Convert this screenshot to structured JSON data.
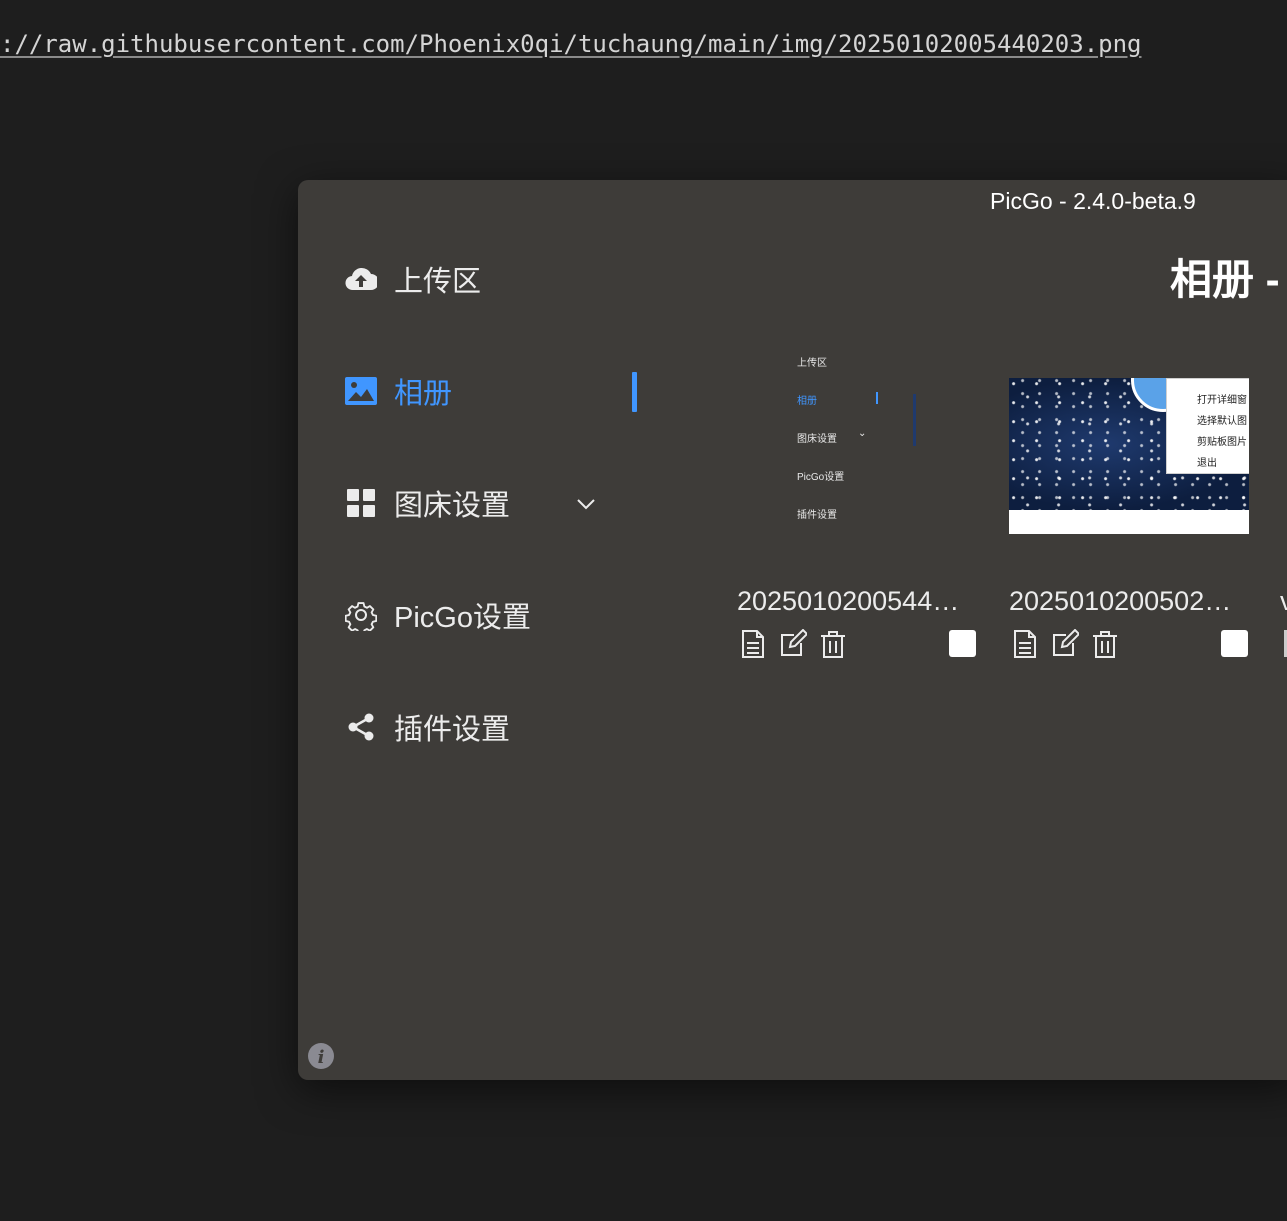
{
  "background_url": "://raw.githubusercontent.com/Phoenix0qi/tuchaung/main/img/20250102005440203.png",
  "window": {
    "title": "PicGo - 2.4.0-beta.9"
  },
  "sidebar": {
    "items": [
      {
        "label": "上传区",
        "icon": "cloud-upload-icon"
      },
      {
        "label": "相册",
        "icon": "image-icon",
        "active": true
      },
      {
        "label": "图床设置",
        "icon": "grid-icon",
        "expandable": true
      },
      {
        "label": "PicGo设置",
        "icon": "gear-icon"
      },
      {
        "label": "插件设置",
        "icon": "share-icon"
      }
    ]
  },
  "main": {
    "title": "相册 -",
    "gallery": [
      {
        "filename": "2025010200544…",
        "preview_menu": [
          "上传区",
          "相册",
          "图床设置",
          "PicGo设置",
          "插件设置"
        ]
      },
      {
        "filename": "2025010200502…",
        "preview_menu": [
          "打开详细窗",
          "选择默认图",
          "剪贴板图片",
          "退出"
        ]
      }
    ],
    "partial_next_char": "v"
  },
  "colors": {
    "accent": "#4096ff",
    "window_bg": "#3e3c39",
    "page_bg": "#1e1e1e"
  }
}
